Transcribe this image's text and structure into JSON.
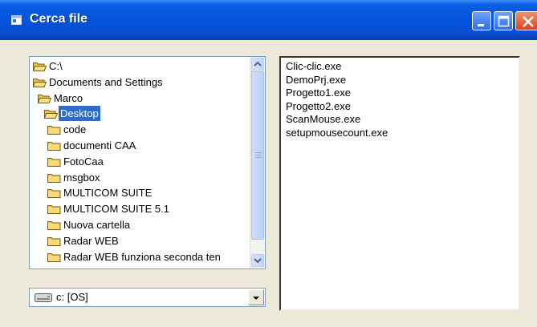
{
  "window": {
    "title": "Cerca file"
  },
  "dirlist": {
    "items": [
      {
        "label": "C:\\",
        "type": "open"
      },
      {
        "label": "Documents and Settings",
        "type": "open"
      },
      {
        "label": "Marco",
        "type": "open"
      },
      {
        "label": "Desktop",
        "type": "open",
        "selected": true
      },
      {
        "label": "code",
        "type": "closed"
      },
      {
        "label": "documenti CAA",
        "type": "closed"
      },
      {
        "label": "FotoCaa",
        "type": "closed"
      },
      {
        "label": "msgbox",
        "type": "closed"
      },
      {
        "label": "MULTICOM SUITE",
        "type": "closed"
      },
      {
        "label": "MULTICOM SUITE 5.1",
        "type": "closed"
      },
      {
        "label": "Nuova cartella",
        "type": "closed"
      },
      {
        "label": "Radar WEB",
        "type": "closed"
      },
      {
        "label": "Radar WEB funziona seconda ten",
        "type": "closed"
      }
    ]
  },
  "filelist": {
    "items": [
      "Clic-clic.exe",
      "DemoPrj.exe",
      "Progetto1.exe",
      "Progetto2.exe",
      "ScanMouse.exe",
      "setupmousecount.exe"
    ]
  },
  "drive": {
    "selected": "c: [OS]"
  },
  "colors": {
    "titlebar": "#0554e0",
    "selection": "#316ac5",
    "face": "#ece9d8"
  },
  "icons": {
    "title": "window-icon",
    "folder": "folder-icon",
    "drive": "drive-icon"
  }
}
